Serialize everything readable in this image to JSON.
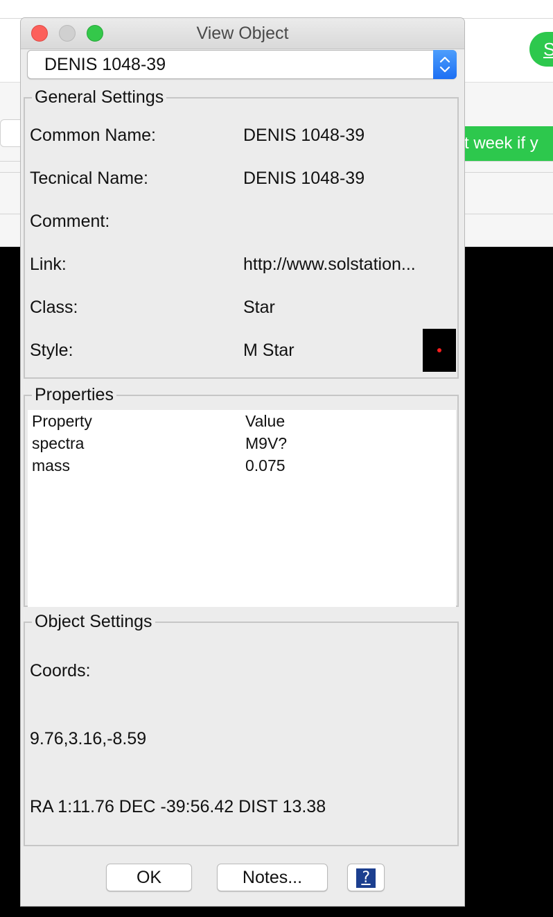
{
  "background_app": {
    "green_circle_text": "S",
    "green_banner_text": "xt week if y",
    "tick_text": "t"
  },
  "window": {
    "title": "View Object"
  },
  "object_select": {
    "value": "DENIS 1048-39"
  },
  "general_settings": {
    "title": "General Settings",
    "common_name_label": "Common Name:",
    "common_name_value": "DENIS 1048-39",
    "technical_name_label": "Tecnical Name:",
    "technical_name_value": "DENIS 1048-39",
    "comment_label": "Comment:",
    "comment_value": "",
    "link_label": "Link:",
    "link_value": "http://www.solstation...",
    "class_label": "Class:",
    "class_value": "Star",
    "style_label": "Style:",
    "style_value": "M Star",
    "style_swatch_color": "#000000",
    "style_dot_color": "#ff1e1e"
  },
  "properties": {
    "title": "Properties",
    "columns": [
      "Property",
      "Value"
    ],
    "rows": [
      {
        "property": "spectra",
        "value": "M9V?"
      },
      {
        "property": "mass",
        "value": "0.075"
      }
    ]
  },
  "object_settings": {
    "title": "Object Settings",
    "coords_label": "Coords:",
    "coords_value": "9.76,3.16,-8.59",
    "ra_dec_dist": "RA 1:11.76 DEC -39:56.42 DIST 13.38"
  },
  "buttons": {
    "ok": "OK",
    "notes": "Notes...",
    "help_glyph": "?"
  },
  "colors": {
    "accent_blue": "#1d6ff3",
    "traffic_close": "#fc605b",
    "traffic_min": "#d0d0d0",
    "traffic_max": "#34c84a",
    "bg_green": "#2dc84d"
  }
}
